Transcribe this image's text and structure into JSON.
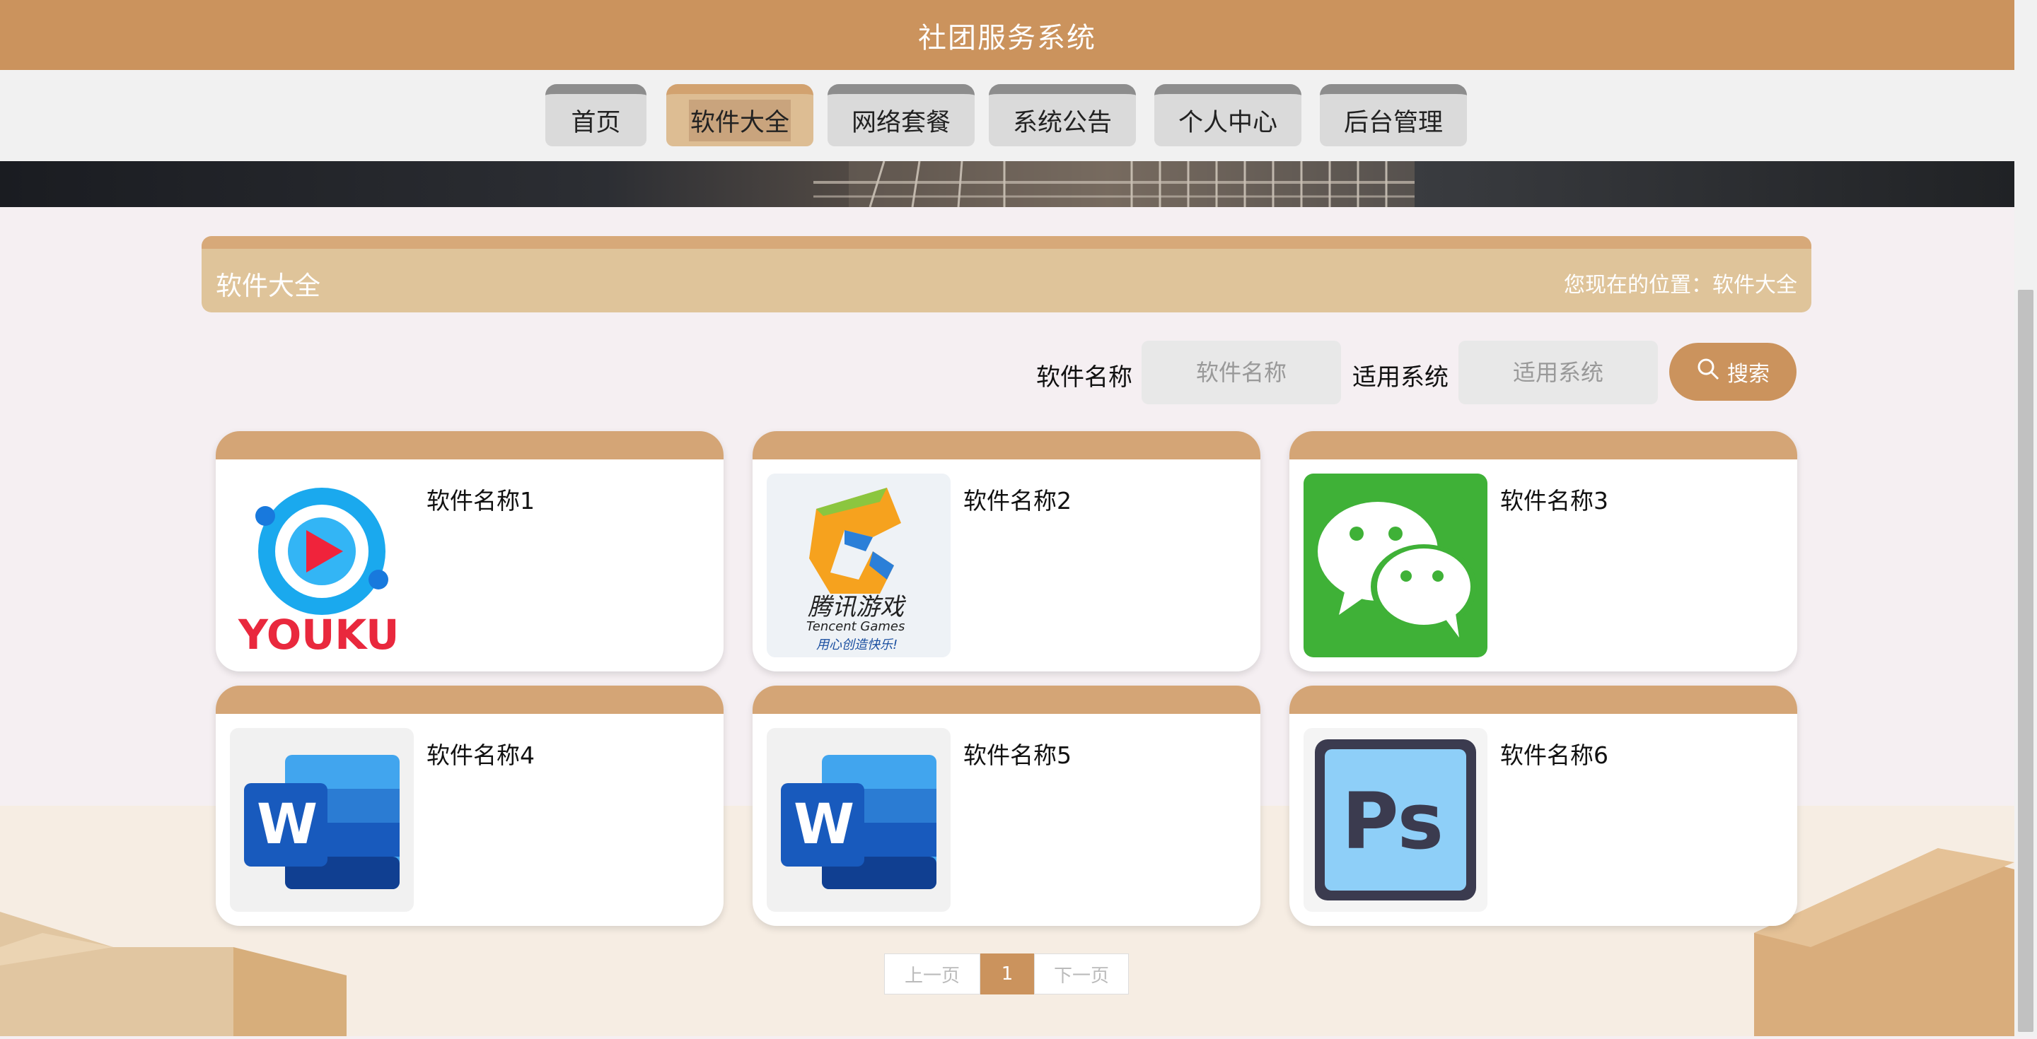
{
  "header": {
    "title": "社团服务系统"
  },
  "nav": [
    {
      "label": "首页",
      "active": false
    },
    {
      "label": "软件大全",
      "active": true
    },
    {
      "label": "网络套餐",
      "active": false
    },
    {
      "label": "系统公告",
      "active": false
    },
    {
      "label": "个人中心",
      "active": false
    },
    {
      "label": "后台管理",
      "active": false
    }
  ],
  "section": {
    "title": "软件大全",
    "breadcrumb": "您现在的位置：软件大全"
  },
  "search": {
    "name_label": "软件名称",
    "name_placeholder": "软件名称",
    "system_label": "适用系统",
    "system_placeholder": "适用系统",
    "button_label": "搜索",
    "button_icon": "search-icon"
  },
  "cards": [
    {
      "name": "软件名称1",
      "icon": "youku-logo"
    },
    {
      "name": "软件名称2",
      "icon": "tencent-games-logo"
    },
    {
      "name": "软件名称3",
      "icon": "wechat-logo"
    },
    {
      "name": "软件名称4",
      "icon": "word-logo"
    },
    {
      "name": "软件名称5",
      "icon": "word-logo"
    },
    {
      "name": "软件名称6",
      "icon": "photoshop-logo"
    }
  ],
  "logo_text": {
    "youku": "YOUKU",
    "tencent_cn": "腾讯游戏",
    "tencent_en": "Tencent Games",
    "tencent_slogan": "用心创造快乐!",
    "word": "W",
    "ps": "Ps"
  },
  "pager": {
    "prev": "上一页",
    "current": "1",
    "next": "下一页"
  },
  "colors": {
    "primary": "#cb935d",
    "card_cap": "#d4a576",
    "section": "#dfc49a"
  }
}
